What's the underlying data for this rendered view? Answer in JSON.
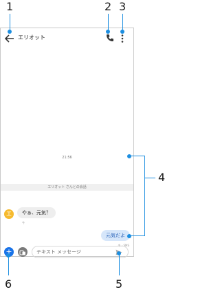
{
  "header": {
    "contact_name": "エリオット"
  },
  "conversation": {
    "time": "21:56",
    "label": "エリオット さんとの会話",
    "incoming_avatar": "エ",
    "incoming_text": "やぁ、元気？",
    "incoming_meta": "今",
    "outgoing_text": "元気だよ",
    "outgoing_meta": "今・SMS"
  },
  "composer": {
    "placeholder": "テキスト メッセージ",
    "add_glyph": "+"
  },
  "callouts": [
    "1",
    "2",
    "3",
    "4",
    "5",
    "6"
  ],
  "colors": {
    "accent": "#1a73e8",
    "callout": "#1c8ee0",
    "avatar": "#f6ba2e",
    "outgoing_bubble": "#d6e6fa"
  },
  "icons": [
    "back-arrow-icon",
    "phone-icon",
    "more-vert-icon",
    "add-icon",
    "media-icon",
    "send-icon"
  ]
}
